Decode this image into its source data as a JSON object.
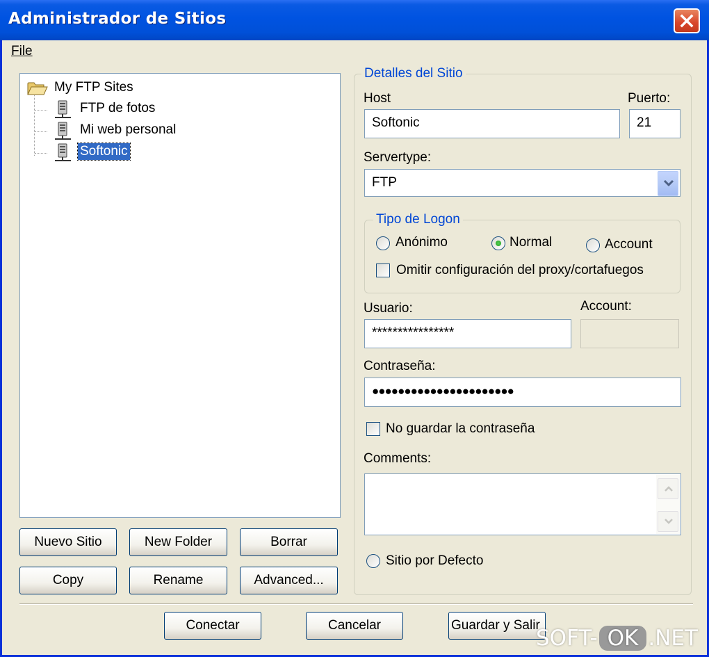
{
  "window": {
    "title": "Administrador de Sitios"
  },
  "menu": {
    "file": "File"
  },
  "tree": {
    "root": "My FTP Sites",
    "items": [
      {
        "label": "FTP de fotos",
        "selected": false
      },
      {
        "label": "Mi web personal",
        "selected": false
      },
      {
        "label": "Softonic",
        "selected": true
      }
    ]
  },
  "tree_buttons": {
    "new_site": "Nuevo Sitio",
    "new_folder": "New Folder",
    "delete": "Borrar",
    "copy": "Copy",
    "rename": "Rename",
    "advanced": "Advanced..."
  },
  "details": {
    "group_title": "Detalles del Sitio",
    "host_label": "Host",
    "host_value": "Softonic",
    "port_label": "Puerto:",
    "port_value": "21",
    "servertype_label": "Servertype:",
    "servertype_value": "FTP",
    "logon_group_title": "Tipo de Logon",
    "logon_options": [
      "Anónimo",
      "Normal",
      "Account"
    ],
    "logon_selected": "Normal",
    "bypass_proxy_label": "Omitir configuración del proxy/cortafuegos",
    "user_label": "Usuario:",
    "user_value": "****************",
    "account_label": "Account:",
    "account_value": "",
    "password_label": "Contraseña:",
    "password_value": "●●●●●●●●●●●●●●●●●●●●●●",
    "dont_save_password_label": "No guardar la contraseña",
    "comments_label": "Comments:",
    "comments_value": "",
    "default_site_label": "Sitio por Defecto"
  },
  "footer_buttons": {
    "connect": "Conectar",
    "cancel": "Cancelar",
    "save_exit": "Guardar y Salir"
  },
  "watermark": {
    "left": "SOFT-",
    "middle": "OK",
    "right": ".NET"
  }
}
